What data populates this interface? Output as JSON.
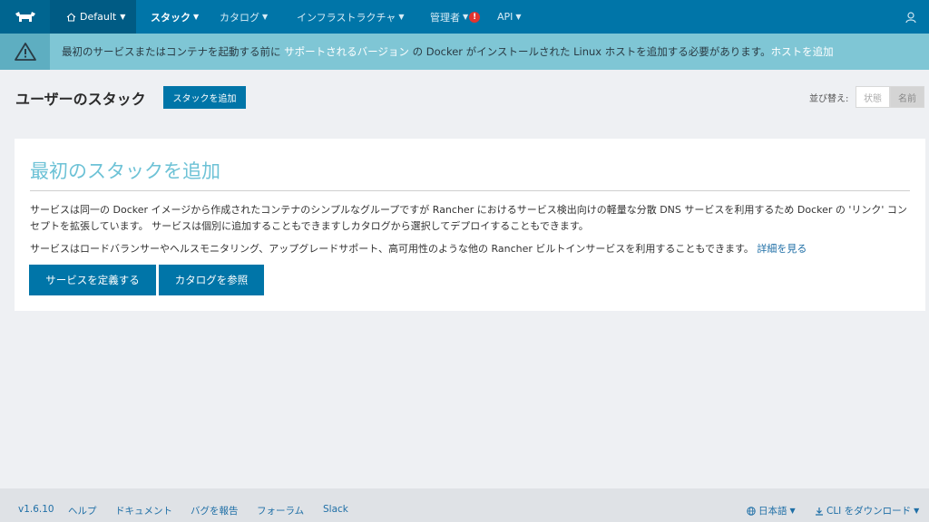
{
  "colors": {
    "nav_bg": "#0075a8",
    "env_bg": "#005b84",
    "banner_bg": "#7fc6d5",
    "accent_title": "#6dc2d6",
    "alert": "#e3342f"
  },
  "nav": {
    "logo_icon": "rancher-cow-icon",
    "environment": "Default",
    "items": [
      {
        "label": "スタック"
      },
      {
        "label": "カタログ"
      },
      {
        "label": "インフラストラクチャ"
      },
      {
        "label": "管理者"
      },
      {
        "label": "API"
      }
    ],
    "admin_alert": "!"
  },
  "banner": {
    "icon": "warning-icon",
    "text_before": "最初のサービスまたはコンテナを起動する前に ",
    "link_supported": "サポートされるバージョン",
    "text_middle": " の Docker がインストールされた Linux ホストを追加する必要があります。",
    "link_add_host": "ホストを追加"
  },
  "header": {
    "title": "ユーザーのスタック",
    "add_stack_label": "スタックを追加",
    "sort_label": "並び替え:",
    "sort_options": [
      "状態",
      "名前"
    ],
    "sort_selected": "名前"
  },
  "card": {
    "title": "最初のスタックを追加",
    "para1": "サービスは同一の Docker イメージから作成されたコンテナのシンプルなグループですが Rancher におけるサービス検出向けの軽量な分散 DNS サービスを利用するため Docker の 'リンク' コンセプトを拡張しています。 サービスは個別に追加することもできますしカタログから選択してデプロイすることもできます。",
    "para2": "サービスはロードバランサーやヘルスモニタリング、アップグレードサポート、高可用性のような他の Rancher ビルトインサービスを利用することもできます。",
    "learn_more": "詳細を見る",
    "define_service_label": "サービスを定義する",
    "browse_catalog_label": "カタログを参照"
  },
  "footer": {
    "version": "v1.6.10",
    "help": "ヘルプ",
    "docs": "ドキュメント",
    "report_bug": "バグを報告",
    "forums": "フォーラム",
    "slack": "Slack",
    "language": "日本語",
    "cli_download": "CLI をダウンロード"
  }
}
